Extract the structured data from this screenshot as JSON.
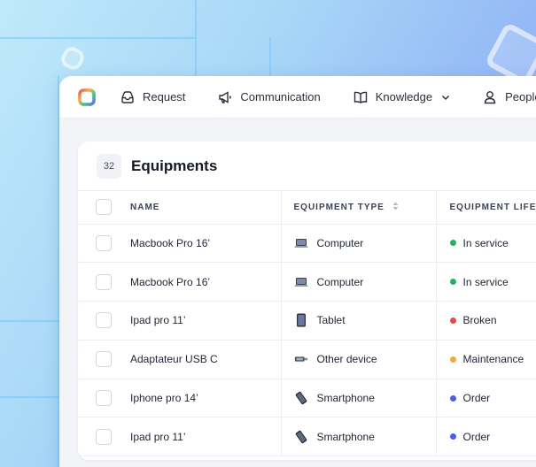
{
  "nav": {
    "items": [
      {
        "label": "Request",
        "icon": "inbox-icon"
      },
      {
        "label": "Communication",
        "icon": "megaphone-icon"
      },
      {
        "label": "Knowledge",
        "icon": "book-icon"
      },
      {
        "label": "People",
        "icon": "person-icon"
      }
    ]
  },
  "card": {
    "count": "32",
    "title": "Equipments"
  },
  "table": {
    "headers": {
      "name": "NAME",
      "type": "EQUIPMENT TYPE",
      "lifecycle": "EQUIPMENT LIFEC"
    },
    "rows": [
      {
        "name": "Macbook Pro 16’",
        "type": "Computer",
        "device_icon": "laptop-icon",
        "status": "In service",
        "status_color": "#22b35e"
      },
      {
        "name": "Macbook Pro 16’",
        "type": "Computer",
        "device_icon": "laptop-icon",
        "status": "In service",
        "status_color": "#22b35e"
      },
      {
        "name": "Ipad pro 11’",
        "type": "Tablet",
        "device_icon": "tablet-icon",
        "status": "Broken",
        "status_color": "#e5484d"
      },
      {
        "name": "Adaptateur USB C",
        "type": "Other device",
        "device_icon": "adapter-icon",
        "status": "Maintenance",
        "status_color": "#f2a93b"
      },
      {
        "name": "Iphone pro 14’",
        "type": "Smartphone",
        "device_icon": "smartphone-icon",
        "status": "Order",
        "status_color": "#4b5ee4"
      },
      {
        "name": "Ipad pro 11’",
        "type": "Smartphone",
        "device_icon": "smartphone-icon",
        "status": "Order",
        "status_color": "#4b5ee4"
      }
    ]
  }
}
